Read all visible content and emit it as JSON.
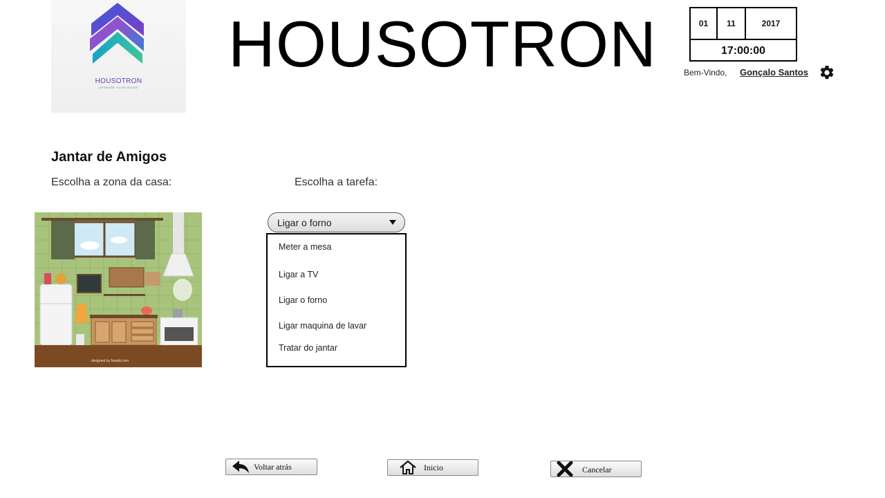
{
  "header": {
    "app_title": "HOUSOTRON",
    "logo_text": "HOUSOTRON",
    "logo_tagline": "UPGRADE YOUR HOUSE"
  },
  "datetime": {
    "day": "01",
    "month": "11",
    "year": "2017",
    "time": "17:00:00"
  },
  "user": {
    "welcome_label": "Bem-Vindo,",
    "name": "Gonçalo Santos"
  },
  "main": {
    "title": "Jantar de Amigos",
    "zone_label": "Escolha a zona da casa:",
    "task_label": "Escolha a tarefa:",
    "kitchen_credit": "designed by freepik.com"
  },
  "task_select": {
    "selected": "Ligar o forno",
    "options": [
      "Meter a mesa",
      "Ligar a TV",
      "Ligar o forno",
      "Ligar maquina de lavar",
      "Tratar do jantar"
    ]
  },
  "footer": {
    "back_label": "Voltar atrás",
    "home_label": "Inicio",
    "cancel_label": "Cancelar"
  },
  "icons": {
    "settings": "gear-icon",
    "back": "back-arrow-icon",
    "home": "home-icon",
    "cancel": "close-icon"
  }
}
